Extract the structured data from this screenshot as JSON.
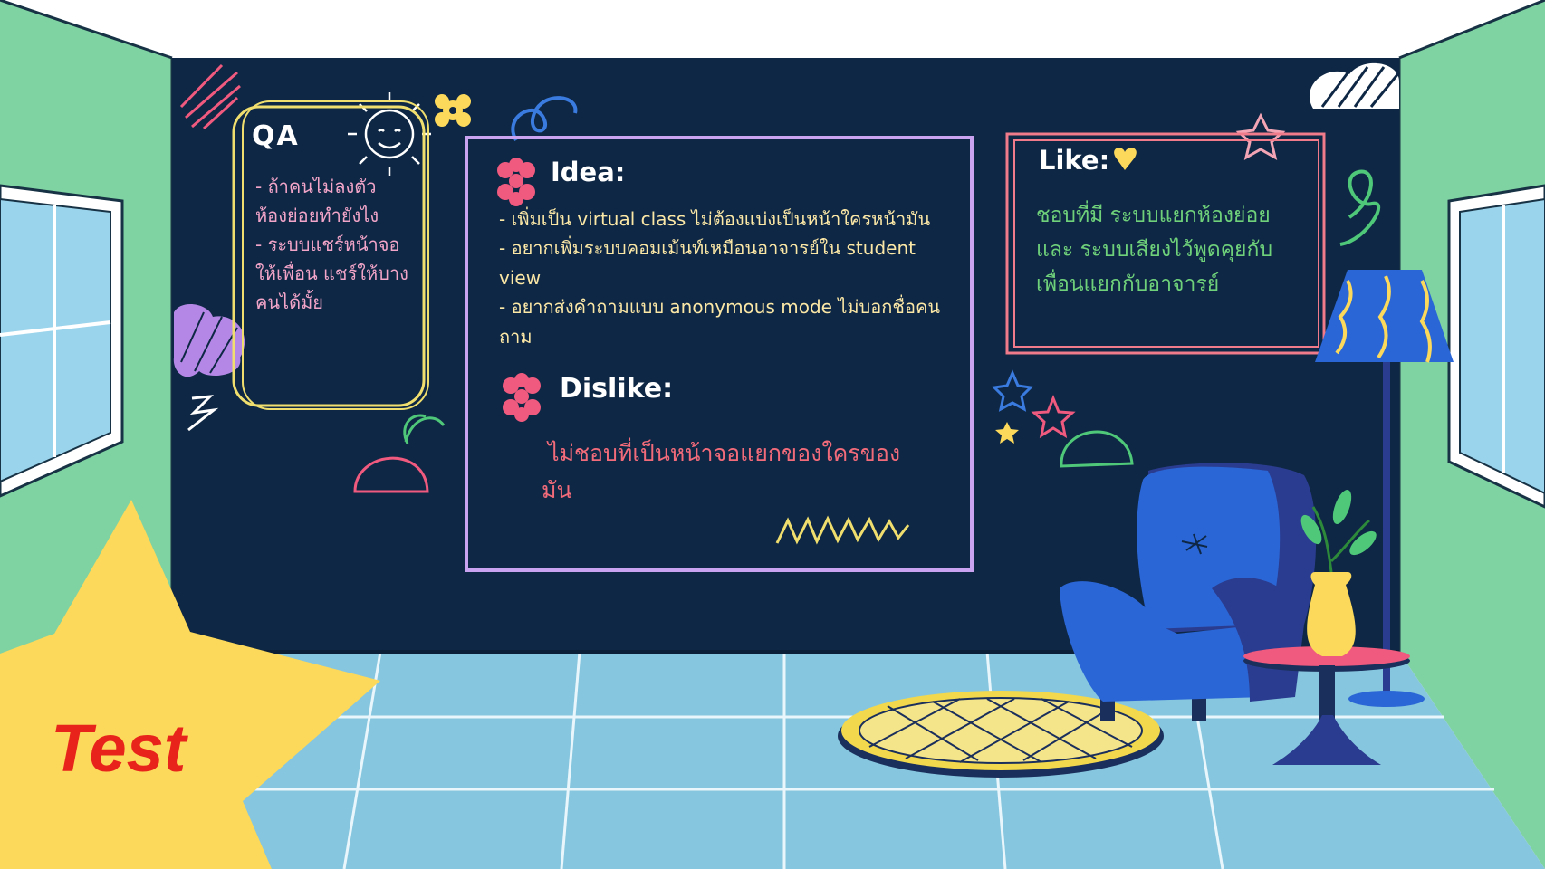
{
  "qa": {
    "title": "QA",
    "body": "- ถ้าคนไม่ลงตัว\nห้องย่อยทำยังไง\n- ระบบแชร์หน้าจอ\nให้เพื่อน แชร์ให้บาง\nคนได้มั้ย"
  },
  "idea": {
    "title": "Idea:",
    "body": "- เพิ่มเป็น virtual class ไม่ต้องแบ่งเป็นหน้าใครหน้ามัน\n- อยากเพิ่มระบบคอมเม้นท์เหมือนอาจารย์ใน student\nview\n- อยากส่งคำถามแบบ anonymous mode ไม่บอกชื่อคน\nถาม"
  },
  "dislike": {
    "title": "Dislike:",
    "body": "ไม่ชอบที่เป็นหน้าจอแยกของใครของ\nมัน"
  },
  "like": {
    "title": "Like:",
    "body": "ชอบที่มี ระบบแยกห้องย่อย\nและ ระบบเสียงไว้พูดคุยกับ\nเพื่อนแยกกับอาจารย์"
  },
  "badge": {
    "label": "Test"
  },
  "colors": {
    "board": "#0e2744",
    "wall": "#7fd3a2",
    "floor": "#86c6de",
    "qa_frame": "#f0df6e",
    "idea_frame": "#c9a2f0",
    "like_frame": "#f07b8a",
    "star": "#fcd95a",
    "chair": "#2a66d6"
  }
}
